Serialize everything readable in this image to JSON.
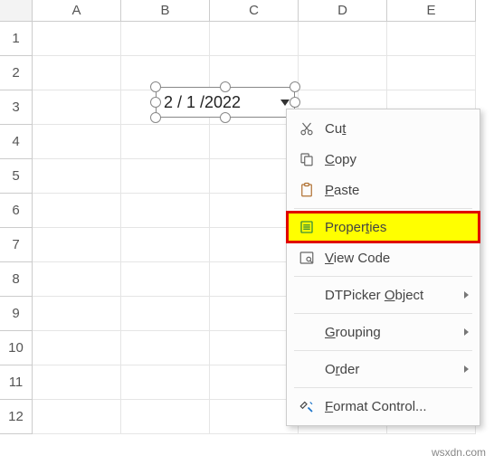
{
  "columns": [
    "A",
    "B",
    "C",
    "D",
    "E"
  ],
  "rows": [
    "1",
    "2",
    "3",
    "4",
    "5",
    "6",
    "7",
    "8",
    "9",
    "10",
    "11",
    "12"
  ],
  "dtpicker": {
    "value": "2 / 1 /2022"
  },
  "menu": {
    "cut": "Cut",
    "copy": "Copy",
    "paste": "Paste",
    "properties": "Properties",
    "view_code": "View Code",
    "dtpicker_object": "DTPicker Object",
    "grouping": "Grouping",
    "order": "Order",
    "format_control": "Format Control..."
  },
  "watermark": "wsxdn.com"
}
